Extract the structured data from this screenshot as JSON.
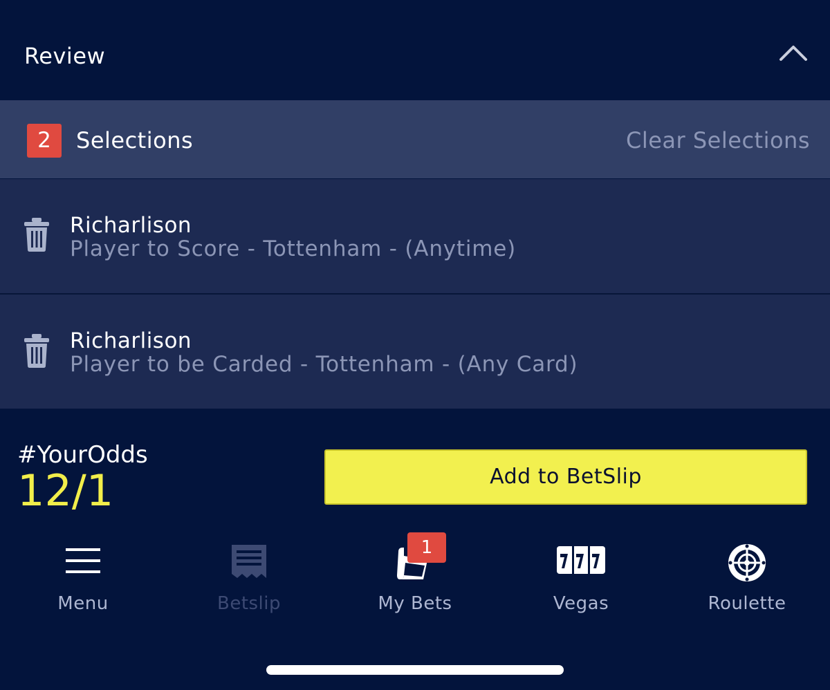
{
  "header": {
    "title": "Review"
  },
  "selections": {
    "count": "2",
    "label": "Selections",
    "clear_label": "Clear Selections",
    "items": [
      {
        "name": "Richarlison",
        "description": "Player to Score - Tottenham - (Anytime)"
      },
      {
        "name": "Richarlison",
        "description": "Player to be Carded - Tottenham - (Any Card)"
      }
    ]
  },
  "odds": {
    "label": "#YourOdds",
    "value": "12/1"
  },
  "add_button": {
    "label": "Add to BetSlip"
  },
  "nav": {
    "items": [
      {
        "label": "Menu",
        "icon": "menu-icon"
      },
      {
        "label": "Betslip",
        "icon": "betslip-icon"
      },
      {
        "label": "My Bets",
        "icon": "my-bets-icon",
        "badge": "1"
      },
      {
        "label": "Vegas",
        "icon": "vegas-icon"
      },
      {
        "label": "Roulette",
        "icon": "roulette-icon"
      }
    ]
  },
  "colors": {
    "background": "#03143c",
    "selection_bar": "#313f66",
    "row": "#1d2a52",
    "badge": "#e04a40",
    "odds": "#f2ee4a",
    "button": "#f2f04f",
    "muted_text": "#8c96b6"
  }
}
